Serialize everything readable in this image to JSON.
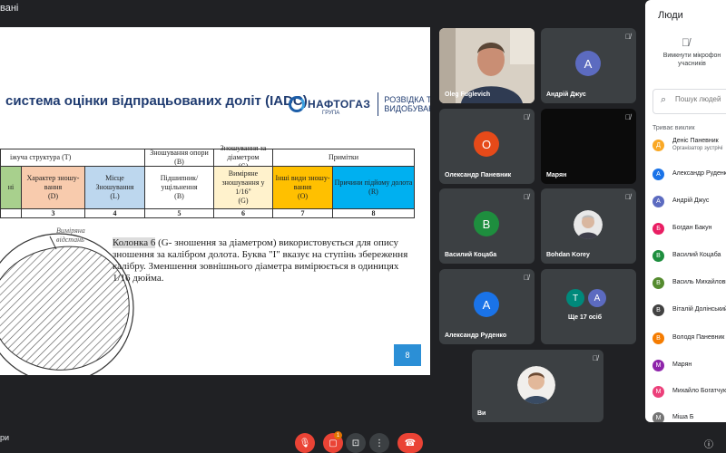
{
  "topbar": {
    "title_fragment": "вані"
  },
  "slide": {
    "title": "система оцінки відпрацьованих доліт (IADC)",
    "brand_name": "НАФТОГАЗ",
    "brand_sub": "ГРУПА",
    "brand_right_line1": "РОЗВІДКА ТА",
    "brand_right_line2": "ВИДОБУВАННЯ",
    "headers": {
      "group1": "іжуча структура",
      "group1_code": "(T)",
      "group2": "Зношування опори",
      "group2_code": "(B)",
      "group3": "Зношування за діаметром",
      "group3_code": "(G)",
      "group4": "Примітки"
    },
    "columns": [
      {
        "label": "ні",
        "code": "",
        "num": ""
      },
      {
        "label": "Характер зношу-вання",
        "code": "(D)",
        "num": "3"
      },
      {
        "label": "Місце Зношування",
        "code": "(L)",
        "num": "4"
      },
      {
        "label": "Підшипник/ ущільнення",
        "code": "(B)",
        "num": "5"
      },
      {
        "label": "Виміряне зношування у 1/16\"",
        "code": "(G)",
        "num": "6"
      },
      {
        "label": "Інші види зношу-вання",
        "code": "(O)",
        "num": "7"
      },
      {
        "label": "Причини підйому долота",
        "code": "(R)",
        "num": "8"
      }
    ],
    "drawing_label_line1": "Виміряна",
    "drawing_label_line2": "відстань",
    "text_highlight": "Колонка 6",
    "text_rest": " (G- зношення за діаметром) використовується для опису зношення  за калібром долота. Буква \"I\" вказує на ступінь збереження калібру. Зменшення зовнішнього діаметра вимірюється в одиницях 1/16 дюйма.",
    "page_number": "8"
  },
  "tiles": [
    {
      "name": "Oleg Fuglevich",
      "kind": "photo"
    },
    {
      "name": "Андрій Джус",
      "initial": "А",
      "color": "#5c6bc0"
    },
    {
      "name": "Олександр Паневник",
      "initial": "О",
      "color": "#e64a19"
    },
    {
      "name": "Марян",
      "kind": "dark"
    },
    {
      "name": "Василий Коцаба",
      "initial": "В",
      "color": "#1e8e3e"
    },
    {
      "name": "Bohdan Korey",
      "kind": "photo"
    },
    {
      "name": "Александр Руденко",
      "initial": "А",
      "color": "#1a73e8"
    },
    {
      "name": "Ще 17 осіб",
      "initials": [
        "T",
        "A"
      ]
    },
    {
      "name": "Ви",
      "kind": "photo"
    }
  ],
  "panel": {
    "title": "Люди",
    "mute_line1": "Вимкнути мікрофон",
    "mute_line2": "учасників",
    "search_placeholder": "Пошук людей",
    "section": "Триває виклик",
    "people": [
      {
        "initial": "Д",
        "name": "Деніс Паневник",
        "sub": "Організатор зустрічі",
        "color": "#f9a825"
      },
      {
        "initial": "А",
        "name": "Александр Руденко",
        "sub": "",
        "color": "#1a73e8"
      },
      {
        "initial": "А",
        "name": "Андрій Джус",
        "sub": "",
        "color": "#5c6bc0"
      },
      {
        "initial": "Б",
        "name": "Богдан Бакун",
        "sub": "",
        "color": "#e91e63"
      },
      {
        "initial": "В",
        "name": "Василий Коцаба",
        "sub": "",
        "color": "#1e8e3e"
      },
      {
        "initial": "В",
        "name": "Василь Михайлович",
        "sub": "",
        "color": "#558b2f"
      },
      {
        "initial": "В",
        "name": "Віталій Долінський",
        "sub": "",
        "color": "#424242"
      },
      {
        "initial": "В",
        "name": "Володя Паневник",
        "sub": "",
        "color": "#f57c00"
      },
      {
        "initial": "М",
        "name": "Марян",
        "sub": "",
        "color": "#8e24aa"
      },
      {
        "initial": "М",
        "name": "Михайло Богатчук",
        "sub": "",
        "color": "#ec407a"
      },
      {
        "initial": "М",
        "name": "Міша Б",
        "sub": "",
        "color": "#757575"
      }
    ]
  },
  "bottom": {
    "meet_code": "ри",
    "badge": "1"
  }
}
